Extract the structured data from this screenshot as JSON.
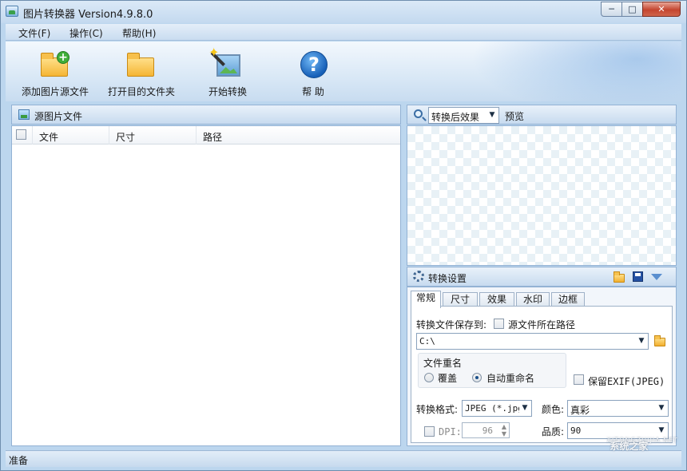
{
  "window": {
    "title": "图片转换器 Version4.9.8.0",
    "min_glyph": "─",
    "max_glyph": "□",
    "close_glyph": "✕"
  },
  "menu": {
    "items": [
      {
        "label": "文件(F)"
      },
      {
        "label": "操作(C)"
      },
      {
        "label": "帮助(H)"
      }
    ]
  },
  "toolbar": {
    "add_source_label": "添加图片源文件",
    "open_dest_label": "打开目的文件夹",
    "start_convert_label": "开始转换",
    "help_label": "帮 助",
    "help_glyph": "?",
    "plus_glyph": "+",
    "star_glyph": "✦"
  },
  "source_panel": {
    "title": "源图片文件",
    "columns": [
      "文件",
      "尺寸",
      "路径"
    ],
    "rows": []
  },
  "preview_panel": {
    "mode_selected": "转换后效果",
    "preview_label": "预览",
    "arrow_glyph": "▼"
  },
  "settings_panel": {
    "title": "转换设置",
    "tabs": [
      {
        "label": "常规",
        "active": true
      },
      {
        "label": "尺寸",
        "active": false
      },
      {
        "label": "效果",
        "active": false
      },
      {
        "label": "水印",
        "active": false
      },
      {
        "label": "边框",
        "active": false
      }
    ],
    "save_to_label": "转换文件保存到:",
    "source_path_checkbox_label": "源文件所在路径",
    "save_path_value": "C:\\",
    "rename_group_label": "文件重名",
    "rename_options": [
      {
        "label": "覆盖",
        "selected": false
      },
      {
        "label": "自动重命名",
        "selected": true
      }
    ],
    "keep_exif_label": "保留EXIF(JPEG)",
    "format_label": "转换格式:",
    "format_value": "JPEG (*.jpg",
    "color_label": "颜色:",
    "color_value": "真彩",
    "dpi_label": "DPI:",
    "dpi_value": "96",
    "quality_label": "品质:",
    "quality_value": "90"
  },
  "status": {
    "text": "准备"
  },
  "watermark": {
    "text": "系统之家",
    "subtext": "XITONGZHIJIA.NET"
  }
}
